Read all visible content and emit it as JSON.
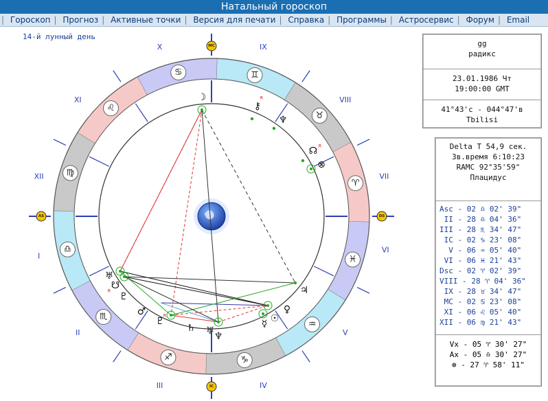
{
  "app": {
    "title": "Натальный гороскоп"
  },
  "menu": [
    "Гороскоп",
    "Прогноз",
    "Активные точки",
    "Версия для печати",
    "Справка",
    "Программы",
    "Астросервис",
    "Форум",
    "Email"
  ],
  "lunar_day": "14-й лунный день",
  "houses_roman": [
    "I",
    "II",
    "III",
    "IV",
    "V",
    "VI",
    "VII",
    "VIII",
    "IX",
    "X",
    "XI",
    "XII"
  ],
  "axis_labels": {
    "as": "AS",
    "ds": "DS",
    "mc": "MC",
    "ic": "IC"
  },
  "zodiac_glyphs": [
    "♋",
    "♌",
    "♍",
    "♎",
    "♏",
    "♐",
    "♑",
    "♒",
    "♓",
    "♈",
    "♉",
    "♊"
  ],
  "planet_glyphs": {
    "moon": "☽",
    "chiron": "⚷",
    "neptune_top": "♆",
    "node": "☊",
    "pluto_circle": "⊗",
    "jupiter": "♃",
    "venus": "♀",
    "sun": "☉",
    "mercury": "☿",
    "neptune": "♆",
    "saturn": "♄",
    "uranus_low": "♅",
    "pluto": "♇",
    "mars": "♂",
    "uranus": "♅",
    "south_node": "☋",
    "pluto2": "♇",
    "retro": "R"
  },
  "panel1": {
    "name": "gg",
    "type": "радикс",
    "date": "23.01.1986 Чт",
    "time": "19:00:00 GMT",
    "coords": "41°43'с - 044°47'в",
    "city": "Tbilisi"
  },
  "panel2": {
    "delta_t": "Delta T  54,9 сек.",
    "sidereal": "Зв.время 6:10:23",
    "ramc": "RAMC 92°35'59\"",
    "system": "Плацидус",
    "cusps": [
      "Asc - 02 ♎ 02' 39\"",
      " II - 28 ♎ 04' 36\"",
      "III - 28 ♏ 34' 47\"",
      " IC - 02 ♑ 23' 08\"",
      "  V - 06 ♒ 05' 40\"",
      " VI - 06 ♓ 21' 43\"",
      "Dsc - 02 ♈ 02' 39\"",
      "VIII - 28 ♈ 04' 36\"",
      " IX - 28 ♉ 34' 47\"",
      " MC - 02 ♋ 23' 08\"",
      " XI - 06 ♌ 05' 40\"",
      "XII - 06 ♍ 21' 43\""
    ],
    "points": [
      "Vx - 05 ♈ 30' 27\"",
      "Ax - 05 ♎ 30' 27\"",
      "⊗ - 27 ♈ 58' 11\""
    ]
  },
  "colors": {
    "title_bg": "#1a6fb3",
    "menu_bg": "#d9e6f2",
    "fire": "#f6c9c9",
    "earth": "#c9c9c9",
    "air": "#b9e8f6",
    "water": "#c9c9f6",
    "axis": "#2b3fb8",
    "axis_dot": "#f5c400"
  }
}
